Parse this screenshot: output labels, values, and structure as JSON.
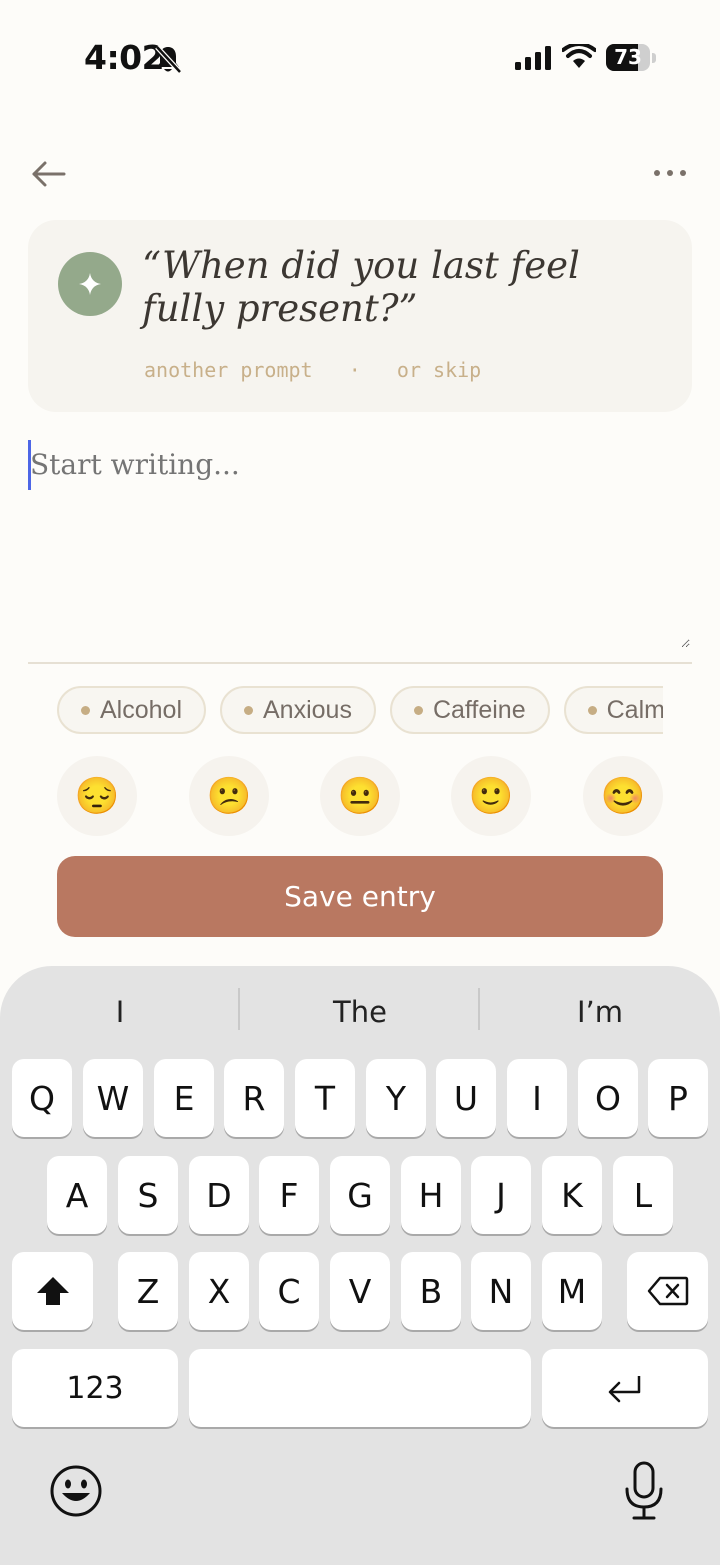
{
  "status": {
    "time": "4:02",
    "battery": "73",
    "battery_level": 0.73
  },
  "prompt": {
    "text": "“When did you last feel fully present?”",
    "another_label": "another prompt",
    "separator": "·",
    "skip_label": "or skip"
  },
  "editor": {
    "placeholder": "Start writing..."
  },
  "tags": [
    "Alcohol",
    "Anxious",
    "Caffeine",
    "Calm"
  ],
  "moods": [
    "😔",
    "😕",
    "😐",
    "🙂",
    "😊"
  ],
  "save_label": "Save entry",
  "keyboard": {
    "suggestions": [
      "I",
      "The",
      "I’m"
    ],
    "row1": [
      "Q",
      "W",
      "E",
      "R",
      "T",
      "Y",
      "U",
      "I",
      "O",
      "P"
    ],
    "row2": [
      "A",
      "S",
      "D",
      "F",
      "G",
      "H",
      "J",
      "K",
      "L"
    ],
    "row3": [
      "Z",
      "X",
      "C",
      "V",
      "B",
      "N",
      "M"
    ],
    "numbers_label": "123"
  }
}
